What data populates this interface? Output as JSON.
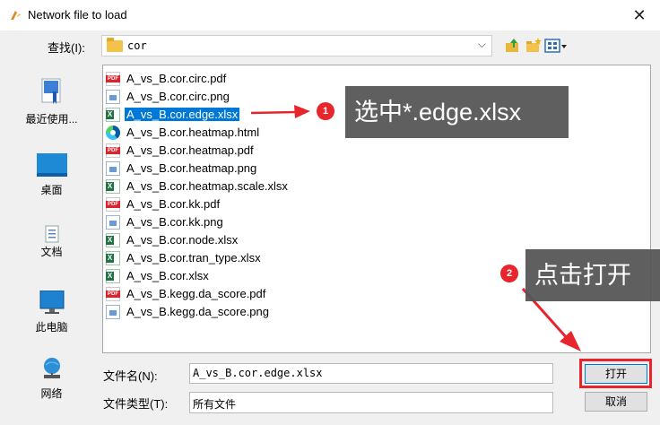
{
  "window": {
    "title": "Network file to load"
  },
  "toolbar": {
    "look_in_label": "查找(I):",
    "current_folder": "cor"
  },
  "places": [
    {
      "label": "最近使用...",
      "icon": "recent-icon"
    },
    {
      "label": "桌面",
      "icon": "desktop-icon"
    },
    {
      "label": "文档",
      "icon": "documents-icon"
    },
    {
      "label": "此电脑",
      "icon": "computer-icon"
    },
    {
      "label": "网络",
      "icon": "network-icon"
    }
  ],
  "files": [
    {
      "name": "A_vs_B.cor.circ.pdf",
      "type": "pdf"
    },
    {
      "name": "A_vs_B.cor.circ.png",
      "type": "png"
    },
    {
      "name": "A_vs_B.cor.edge.xlsx",
      "type": "xlsx",
      "selected": true
    },
    {
      "name": "A_vs_B.cor.heatmap.html",
      "type": "html"
    },
    {
      "name": "A_vs_B.cor.heatmap.pdf",
      "type": "pdf"
    },
    {
      "name": "A_vs_B.cor.heatmap.png",
      "type": "png"
    },
    {
      "name": "A_vs_B.cor.heatmap.scale.xlsx",
      "type": "xlsx"
    },
    {
      "name": "A_vs_B.cor.kk.pdf",
      "type": "pdf"
    },
    {
      "name": "A_vs_B.cor.kk.png",
      "type": "png"
    },
    {
      "name": "A_vs_B.cor.node.xlsx",
      "type": "xlsx"
    },
    {
      "name": "A_vs_B.cor.tran_type.xlsx",
      "type": "xlsx"
    },
    {
      "name": "A_vs_B.cor.xlsx",
      "type": "xlsx"
    },
    {
      "name": "A_vs_B.kegg.da_score.pdf",
      "type": "pdf"
    },
    {
      "name": "A_vs_B.kegg.da_score.png",
      "type": "png"
    }
  ],
  "filename": {
    "label": "文件名(N):",
    "value": "A_vs_B.cor.edge.xlsx"
  },
  "filetype": {
    "label": "文件类型(T):",
    "value": "所有文件"
  },
  "buttons": {
    "open": "打开",
    "cancel": "取消"
  },
  "annotations": [
    {
      "number": "1",
      "text": "选中*.edge.xlsx"
    },
    {
      "number": "2",
      "text": "点击打开"
    }
  ],
  "colors": {
    "selection": "#0078d7",
    "highlight_red": "#e8242c",
    "callout_bg": "#555555"
  }
}
